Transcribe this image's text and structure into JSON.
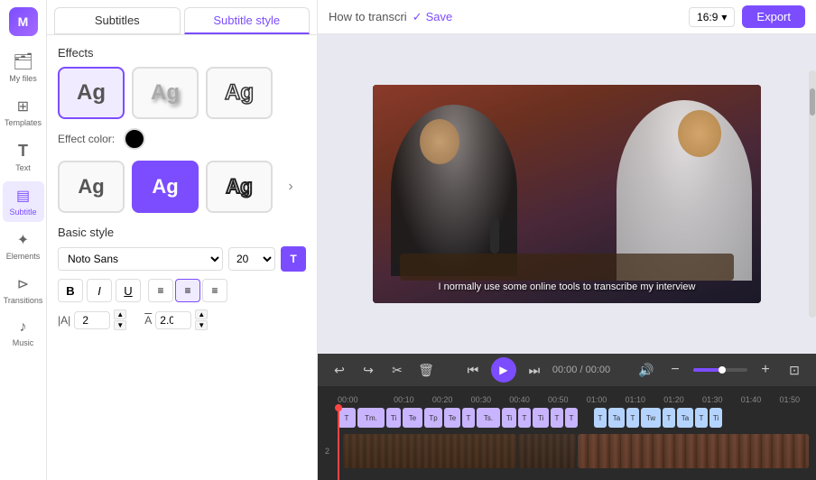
{
  "app": {
    "logo": "M",
    "title": "How to transcri"
  },
  "sidebar": {
    "items": [
      {
        "id": "my-files",
        "label": "My files",
        "icon": "🗂"
      },
      {
        "id": "templates",
        "label": "Templates",
        "icon": "⊞"
      },
      {
        "id": "text",
        "label": "Text",
        "icon": "T"
      },
      {
        "id": "subtitle",
        "label": "Subtitle",
        "icon": "⊡",
        "active": true
      },
      {
        "id": "elements",
        "label": "Elements",
        "icon": "✦"
      },
      {
        "id": "transitions",
        "label": "Transitions",
        "icon": "⊳"
      },
      {
        "id": "music",
        "label": "Music",
        "icon": "♪"
      }
    ]
  },
  "panel": {
    "tabs": [
      {
        "id": "subtitles",
        "label": "Subtitles",
        "active": false
      },
      {
        "id": "subtitle-style",
        "label": "Subtitle style",
        "active": true
      }
    ],
    "effects": {
      "label": "Effects",
      "items": [
        {
          "id": "none",
          "label": "Ag",
          "style": "plain",
          "active": true
        },
        {
          "id": "shadow",
          "label": "Ag",
          "style": "shadow"
        },
        {
          "id": "outline",
          "label": "Ag",
          "style": "outline"
        }
      ],
      "color_label": "Effect color:"
    },
    "style_effects": {
      "items": [
        {
          "id": "plain2",
          "label": "Ag",
          "style": "plain"
        },
        {
          "id": "purple",
          "label": "Ag",
          "style": "purple"
        },
        {
          "id": "bold-outline",
          "label": "Ag",
          "style": "bold-outline"
        }
      ]
    },
    "basic_style": {
      "label": "Basic style",
      "font": "Noto Sans",
      "font_size": "20",
      "bold_label": "B",
      "italic_label": "I",
      "underline_label": "U",
      "align_left": "≡",
      "align_center": "≡",
      "align_right": "≡",
      "letter_spacing_label": "|A|",
      "letter_spacing_value": "2",
      "line_spacing_label": "A̲",
      "line_spacing_value": "2.00"
    }
  },
  "header": {
    "title": "How to transcri",
    "save_label": "Save",
    "aspect_ratio": "16:9",
    "export_label": "Export"
  },
  "preview": {
    "subtitle_text": "I normally use some online tools to transcribe my interview"
  },
  "timeline": {
    "undo_label": "↩",
    "redo_label": "↪",
    "cut_label": "✂",
    "delete_label": "🗑",
    "skip_back_label": "⏮",
    "play_label": "▶",
    "skip_fwd_label": "⏭",
    "time_current": "00:00",
    "time_total": "00:00",
    "volume_label": "🔊",
    "zoom_out_label": "−",
    "zoom_in_label": "+",
    "fit_label": "⊡",
    "ruler_marks": [
      "00:00",
      "",
      "",
      "",
      "00:10",
      "",
      "",
      "",
      "00:20",
      "",
      "",
      "",
      "00:30",
      "",
      "",
      "",
      "00:40",
      "",
      "",
      "",
      "00:50",
      "",
      "",
      "",
      "01:00",
      "",
      "",
      "",
      "01:10",
      "",
      "",
      "",
      "01:20",
      "",
      "",
      "",
      "01:30",
      "",
      "",
      "",
      "01:40",
      "",
      "",
      "",
      "01:50"
    ],
    "track1_clips": [
      "T",
      "Tm.",
      "Ti",
      "Te",
      "Tp",
      "Te",
      "T",
      "Ts.",
      "Ti",
      "T",
      "Ti",
      "T",
      "T",
      "T"
    ],
    "track2_clips": [
      "T",
      "a",
      "T",
      "W",
      "T",
      "a",
      "T",
      "i"
    ],
    "video_track_label": "2"
  }
}
